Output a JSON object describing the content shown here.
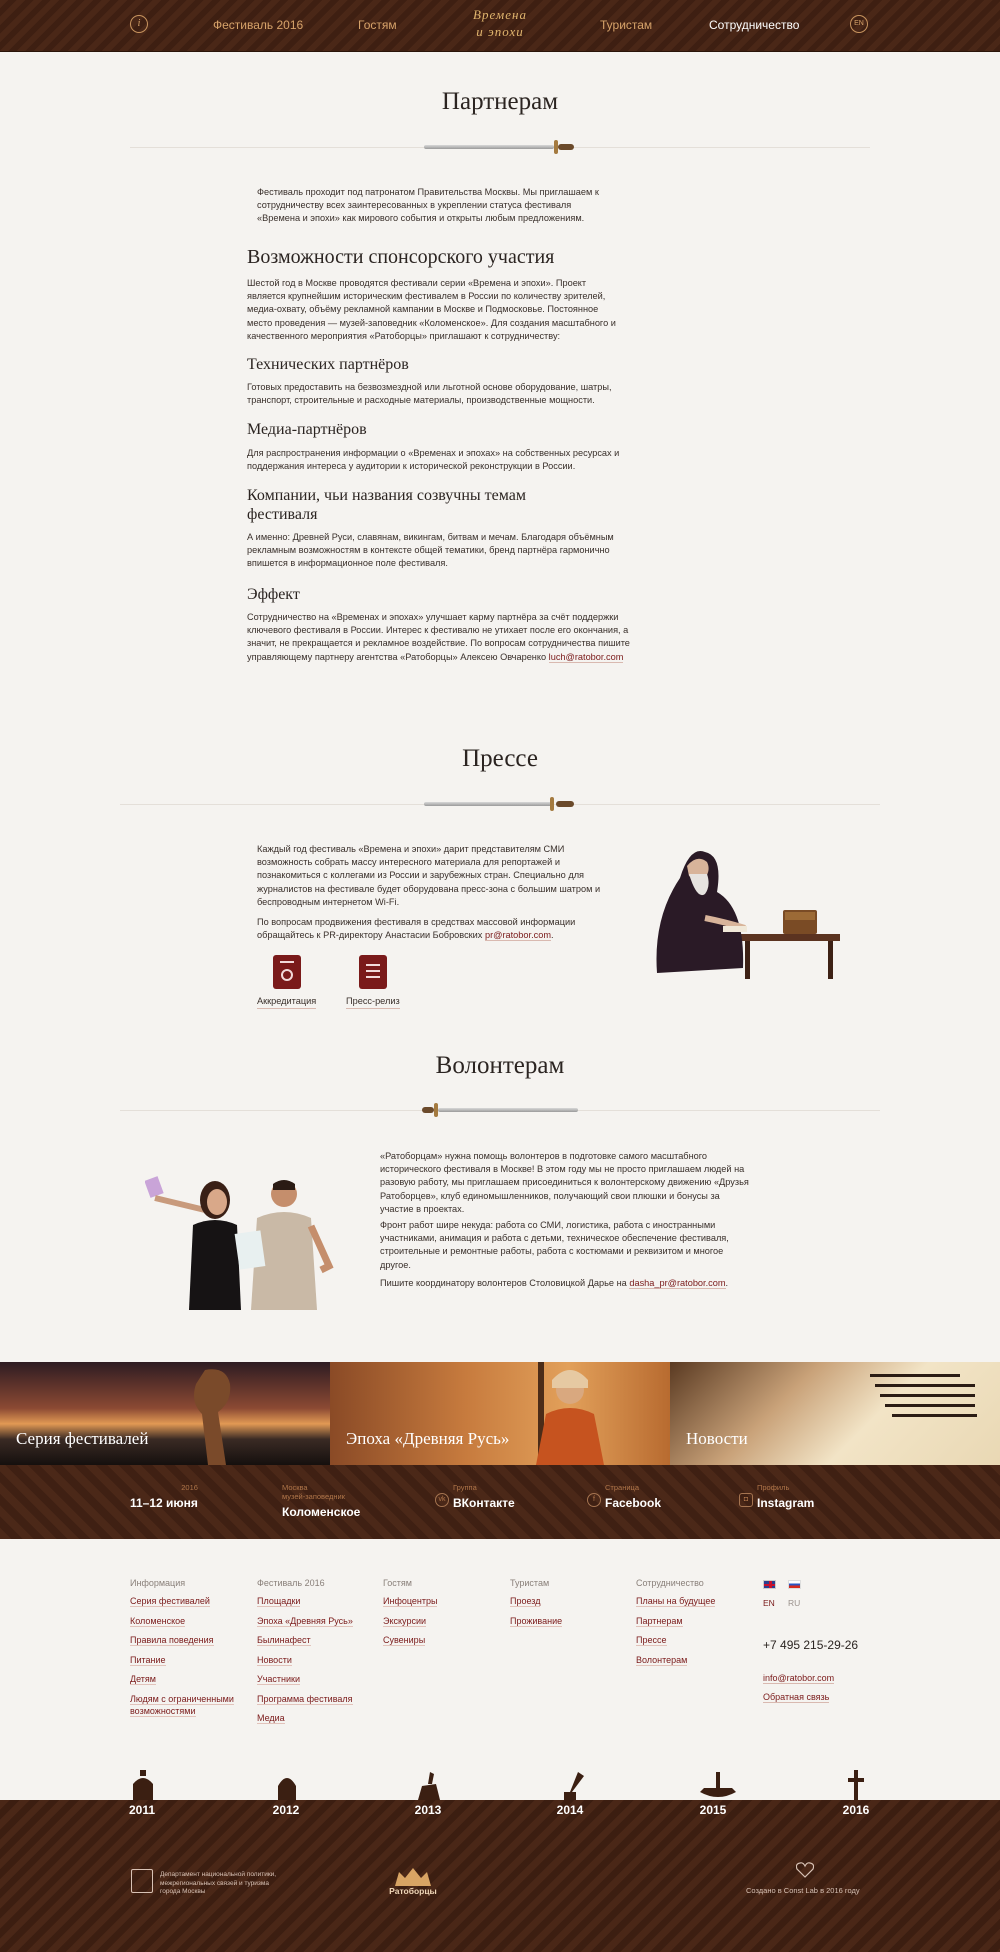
{
  "nav": {
    "info_icon": "i",
    "items": [
      "Фестиваль 2016",
      "Гостям",
      "Туристам",
      "Сотрудничество"
    ],
    "logo_line1": "Времена",
    "logo_line2": "и эпохи",
    "lang_icon": "EN"
  },
  "partners": {
    "title": "Партнерам",
    "intro": "Фестиваль проходит под патронатом Правительства Москвы. Мы приглашаем к сотрудничеству всех заинтересованных в укреплении статуса фестиваля «Времена и эпохи» как мирового события и открыты любым предложениям.",
    "h_sponsor": "Возможности спонсорского участия",
    "sponsor_text": "Шестой год в Москве проводятся фестивали серии «Времена и эпохи». Проект является крупнейшим историческим фестивалем в России по количеству зрителей, медиа-охвату, объёму рекламной кампании в Москве и Подмосковье. Постоянное место проведения — музей-заповедник «Коломенское». Для создания масштабного и качественного мероприятия «Ратоборцы» приглашают к сотрудничеству:",
    "h_tech": "Технических партнёров",
    "tech_text": "Готовых предоставить на безвозмездной или льготной основе оборудование, шатры, транспорт, строительные и расходные материалы, производственные мощности.",
    "h_media": "Медиа-партнёров",
    "media_text": "Для распространения информации о «Временах и эпохах» на собственных ресурсах и поддержания интереса у аудитории к исторической реконструкции в России.",
    "h_companies": "Компании, чьи названия созвучны темам фестиваля",
    "companies_text": "А именно: Древней Руси, славянам, викингам, битвам и мечам. Благодаря объёмным рекламным возможностям в контексте общей тематики, бренд партнёра гармонично впишется в информационное поле фестиваля.",
    "h_effect": "Эффект",
    "effect_text": "Сотрудничество на «Временах и эпохах» улучшает карму партнёра за счёт поддержки ключевого фестиваля в России. Интерес к фестивалю не утихает после его окончания, а значит, не прекращается и рекламное воздействие. По вопросам сотрудничества пишите управляющему партнеру агентства «Ратоборцы» Алексею Овчаренко",
    "effect_email": "luch@ratobor.com"
  },
  "press": {
    "title": "Прессе",
    "p1": "Каждый год фестиваль «Времена и эпохи» дарит представителям СМИ возможность собрать массу интересного материала для репортажей и познакомиться с коллегами из России и зарубежных стран. Специально для журналистов на фестивале будет оборудована пресс-зона с большим шатром и беспроводным интернетом Wi-Fi.",
    "p2": "По вопросам продвижения фестиваля в средствах массовой информации обращайтесь к PR-директору Анастасии Бобровских",
    "p2_email": "pr@ratobor.com",
    "p2_end": ".",
    "accreditation": "Аккредитация",
    "press_release": "Пресс-релиз"
  },
  "volunteers": {
    "title": "Волонтерам",
    "p1": "«Ратоборцам» нужна помощь волонтеров в подготовке самого масштабного исторического фестиваля в Москве! В этом году мы не просто приглашаем людей на разовую работу, мы приглашаем присоединиться к волонтерскому движению «Друзья Ратоборцев», клуб единомышленников, получающий свои плюшки и бонусы за участие в проектах.",
    "p2": "Фронт работ шире некуда: работа со СМИ, логистика, работа с иностранными участниками, анимация и работа с детьми, техническое обеспечение фестиваля, строительные и ремонтные работы, работа с костюмами и реквизитом и многое другое.",
    "p3": "Пишите координатору волонтеров Столовицкой Дарье на",
    "p3_email": "dasha_pr@ratobor.com",
    "p3_end": "."
  },
  "tiles": [
    "Серия фестивалей",
    "Эпоха «Древняя Русь»",
    "Новости"
  ],
  "infobar": [
    {
      "small": "2016",
      "big": "11–12 июня",
      "icon": ""
    },
    {
      "small": "Москва\nмузей-заповедник",
      "big": "Коломенское",
      "icon": ""
    },
    {
      "small": "Группа",
      "big": "ВКонтакте",
      "icon": "vk"
    },
    {
      "small": "Страница",
      "big": "Facebook",
      "icon": "f"
    },
    {
      "small": "Профиль",
      "big": "Instagram",
      "icon": "◘"
    }
  ],
  "footer": {
    "cols": [
      {
        "head": "Информация",
        "links": [
          "Серия фестивалей",
          "Коломенское",
          "Правила поведения",
          "Питание",
          "Детям",
          "Людям с ограниченными возможностями"
        ]
      },
      {
        "head": "Фестиваль 2016",
        "links": [
          "Площадки",
          "Эпоха «Древняя Русь»",
          "Былинафест",
          "Новости",
          "Участники",
          "Программа фестиваля",
          "Медиа"
        ]
      },
      {
        "head": "Гостям",
        "links": [
          "Инфоцентры",
          "Экскурсии",
          "Сувениры"
        ]
      },
      {
        "head": "Туристам",
        "links": [
          "Проезд",
          "Проживание"
        ]
      },
      {
        "head": "Сотрудничество",
        "links": [
          "Планы на будущее",
          "Партнерам",
          "Прессе",
          "Волонтерам"
        ]
      }
    ],
    "lang_en": "EN",
    "lang_ru": "RU",
    "phone": "+7 495 215-29-26",
    "email": "info@ratobor.com",
    "feedback": "Обратная связь"
  },
  "years": [
    "2011",
    "2012",
    "2013",
    "2014",
    "2015",
    "2016"
  ],
  "bottom": {
    "dept": "Департамент национальной политики, межрегиональных связей и туризма города Москвы",
    "ratobor": "Ратоборцы",
    "credit": "Создано в Const Lab в 2016 году"
  }
}
